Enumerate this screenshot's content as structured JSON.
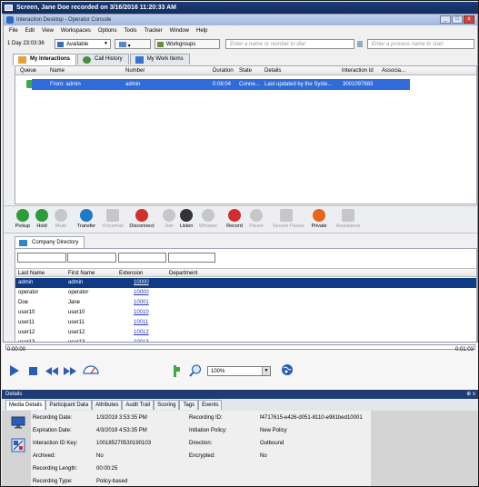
{
  "player_title": "Screen, Jane Doe recorded on 3/16/2016 11:20:33 AM",
  "app_title": "Interaction Desktop - Operator Console",
  "window_buttons": [
    "_",
    "□",
    "x"
  ],
  "menu": [
    "File",
    "Edit",
    "View",
    "Workspaces",
    "Options",
    "Tools",
    "Tracker",
    "Window",
    "Help"
  ],
  "toolbar": {
    "time": "1 Day 23:03:36",
    "status": "Available",
    "workgroups": "Workgroups",
    "dial_placeholder": "Enter a name or number to dial",
    "process_placeholder": "Enter a process name to start"
  },
  "tabs": [
    "My Interactions",
    "Call History",
    "My Work Items"
  ],
  "interaction_columns": [
    "Queue",
    "Name",
    "Number",
    "Duration",
    "State",
    "Details",
    "Interaction Id",
    "Associa..."
  ],
  "interaction_row": {
    "name": "From: admin",
    "number": "admin",
    "duration": "0:08:04",
    "state": "Conne...",
    "details": "Last updated by the Syste...",
    "interaction_id": "3001097883"
  },
  "call_buttons": [
    {
      "label": "Pickup",
      "icon": "check-circle-icon",
      "enabled": true,
      "color": "#2e9b3a"
    },
    {
      "label": "Hold",
      "icon": "pause-circle-icon",
      "enabled": true,
      "color": "#2e9b3a"
    },
    {
      "label": "Mute",
      "icon": "microphone-mute-icon",
      "enabled": false,
      "color": "#c7c7c7"
    },
    {
      "label": "Transfer",
      "icon": "arrow-right-circle-icon",
      "enabled": true,
      "color": "#1f78c8"
    },
    {
      "label": "Voicemail",
      "icon": "voicemail-icon",
      "enabled": false,
      "color": "#c7c7c7"
    },
    {
      "label": "Disconnect",
      "icon": "x-circle-icon",
      "enabled": true,
      "color": "#d12f2f"
    },
    {
      "label": "Join",
      "icon": "join-icon",
      "enabled": false,
      "color": "#c7c7c7"
    },
    {
      "label": "Listen",
      "icon": "headphones-icon",
      "enabled": true,
      "color": "#333333"
    },
    {
      "label": "Whisper",
      "icon": "whisper-icon",
      "enabled": false,
      "color": "#c7c7c7"
    },
    {
      "label": "Record",
      "icon": "record-microphone-icon",
      "enabled": true,
      "color": "#d12f2f"
    },
    {
      "label": "Pause",
      "icon": "pause-microphone-icon",
      "enabled": false,
      "color": "#c7c7c7"
    },
    {
      "label": "Secure Pause",
      "icon": "lock-icon",
      "enabled": false,
      "color": "#c7c7c7"
    },
    {
      "label": "Private",
      "icon": "private-icon",
      "enabled": true,
      "color": "#e8661c"
    },
    {
      "label": "Assistance",
      "icon": "assistance-icon",
      "enabled": false,
      "color": "#c7c7c7"
    }
  ],
  "directory_tab": "Company Directory",
  "directory_columns": [
    "Last Name",
    "First Name",
    "Extension",
    "Department"
  ],
  "directory_rows": [
    {
      "last": "admin",
      "first": "admin",
      "ext": "10000",
      "selected": true
    },
    {
      "last": "operator",
      "first": "operator",
      "ext": "10000",
      "selected": false
    },
    {
      "last": "Doe",
      "first": "Jane",
      "ext": "10001",
      "selected": false
    },
    {
      "last": "user10",
      "first": "user10",
      "ext": "10010",
      "selected": false
    },
    {
      "last": "user11",
      "first": "user11",
      "ext": "10011",
      "selected": false
    },
    {
      "last": "user12",
      "first": "user12",
      "ext": "10012",
      "selected": false
    },
    {
      "last": "user13",
      "first": "user13",
      "ext": "10013",
      "selected": false
    }
  ],
  "player": {
    "position": "0:00:00",
    "duration": "0:01:03",
    "zoom": "100%"
  },
  "details": {
    "header": "Details",
    "tabs": [
      "Media Details",
      "Participant Data",
      "Attributes",
      "Audit Trail",
      "Scoring",
      "Tags",
      "Events"
    ],
    "left": [
      {
        "label": "Recording Date:",
        "value": "1/3/2019 3:53:35 PM"
      },
      {
        "label": "Expiration Date:",
        "value": "4/3/2019 4:53:35 PM"
      },
      {
        "label": "Interaction ID Key:",
        "value": "100185270530190103"
      },
      {
        "label": "Archived:",
        "value": "No"
      },
      {
        "label": "Recording Length:",
        "value": "00:00:25"
      },
      {
        "label": "Recording Type:",
        "value": "Policy-based"
      }
    ],
    "right": [
      {
        "label": "Recording ID:",
        "value": "f4717615-e426-d051-8110-e981bed10001"
      },
      {
        "label": "Initiation Policy:",
        "value": "New Policy"
      },
      {
        "label": "Direction:",
        "value": "Outbound"
      },
      {
        "label": "Encrypted:",
        "value": "No"
      }
    ]
  }
}
